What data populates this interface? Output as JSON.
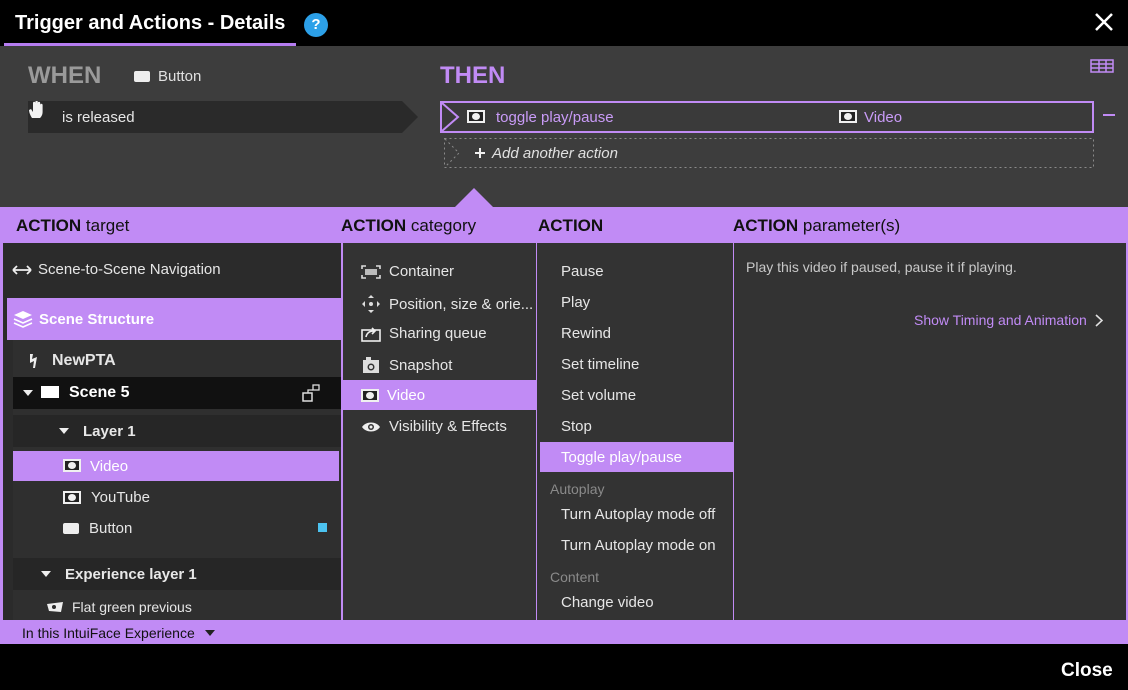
{
  "window": {
    "title": "Trigger and Actions - Details",
    "help_glyph": "?"
  },
  "when": {
    "label": "WHEN",
    "source": "Button",
    "trigger": "is released"
  },
  "then": {
    "label": "THEN",
    "action": {
      "name": "toggle play/pause",
      "target": "Video"
    },
    "add_action": "Add another action"
  },
  "columns": {
    "target": {
      "bold": "ACTION",
      "rest": "target"
    },
    "category": {
      "bold": "ACTION",
      "rest": "category"
    },
    "action": {
      "bold": "ACTION",
      "rest": ""
    },
    "params": {
      "bold": "ACTION",
      "rest": "parameter(s)"
    }
  },
  "targets": {
    "navigation": "Scene-to-Scene Navigation",
    "scene_structure": "Scene Structure",
    "experience": "NewPTA",
    "scene": "Scene 5",
    "layer": "Layer 1",
    "items": [
      "Video",
      "YouTube",
      "Button"
    ],
    "experience_layer": "Experience layer 1",
    "flat_item": "Flat green previous"
  },
  "categories": [
    "Container",
    "Position, size & orie...",
    "Sharing queue",
    "Snapshot",
    "Video",
    "Visibility & Effects"
  ],
  "actions": {
    "main": [
      "Pause",
      "Play",
      "Rewind",
      "Set timeline",
      "Set volume",
      "Stop",
      "Toggle play/pause"
    ],
    "group_autoplay": "Autoplay",
    "autoplay": [
      "Turn Autoplay mode off",
      "Turn Autoplay mode on"
    ],
    "group_content": "Content",
    "content": [
      "Change video"
    ]
  },
  "params": {
    "description": "Play this video if paused, pause it if playing.",
    "timing_link": "Show Timing and Animation"
  },
  "footer": {
    "scope": "In this IntuiFace Experience",
    "close": "Close"
  },
  "colors": {
    "accent": "#c18bf5",
    "help": "#2ca0e8",
    "badge": "#4cc3f0"
  }
}
